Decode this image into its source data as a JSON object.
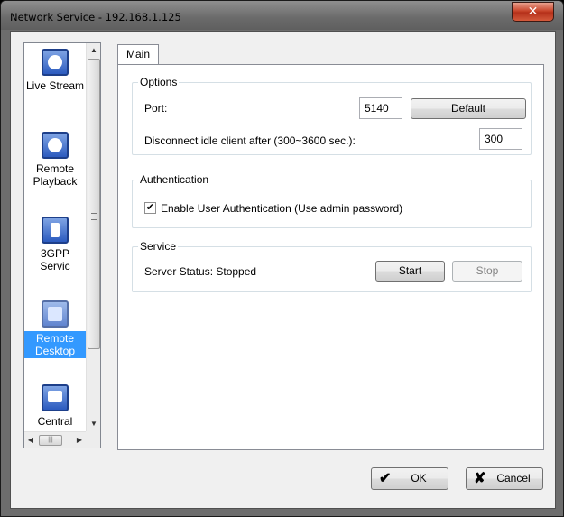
{
  "window": {
    "title": "Network Service - 192.168.1.125",
    "close_glyph": "✕"
  },
  "sidebar": {
    "items": [
      {
        "label": "Live Stream",
        "icon": "live-stream-icon"
      },
      {
        "label": "Remote Playback",
        "icon": "remote-playback-icon"
      },
      {
        "label": "3GPP Servic",
        "icon": "3gpp-service-icon"
      },
      {
        "label": "Remote Desktop",
        "icon": "remote-desktop-icon",
        "selected": true
      },
      {
        "label": "Central",
        "icon": "central-icon"
      }
    ],
    "scroll_up": "▲",
    "scroll_down": "▼",
    "scroll_left": "◀",
    "scroll_right": "▶",
    "hthumb_grip": "|||"
  },
  "tabs": [
    {
      "label": "Main",
      "active": true
    }
  ],
  "options": {
    "legend": "Options",
    "port_label": "Port:",
    "port_value": "5140",
    "default_button": "Default",
    "idle_label": "Disconnect idle client after (300~3600 sec.):",
    "idle_value": "300"
  },
  "authentication": {
    "legend": "Authentication",
    "checkbox_label": "Enable User Authentication (Use admin password)",
    "checked": true,
    "check_glyph": "✔"
  },
  "service": {
    "legend": "Service",
    "status_text": "Server Status: Stopped",
    "start_button": "Start",
    "stop_button": "Stop"
  },
  "footer": {
    "ok_label": "OK",
    "ok_glyph": "✔",
    "cancel_label": "Cancel",
    "cancel_glyph": "✘"
  },
  "colors": {
    "selection": "#3399ff",
    "group_border": "#d5dfe5"
  }
}
